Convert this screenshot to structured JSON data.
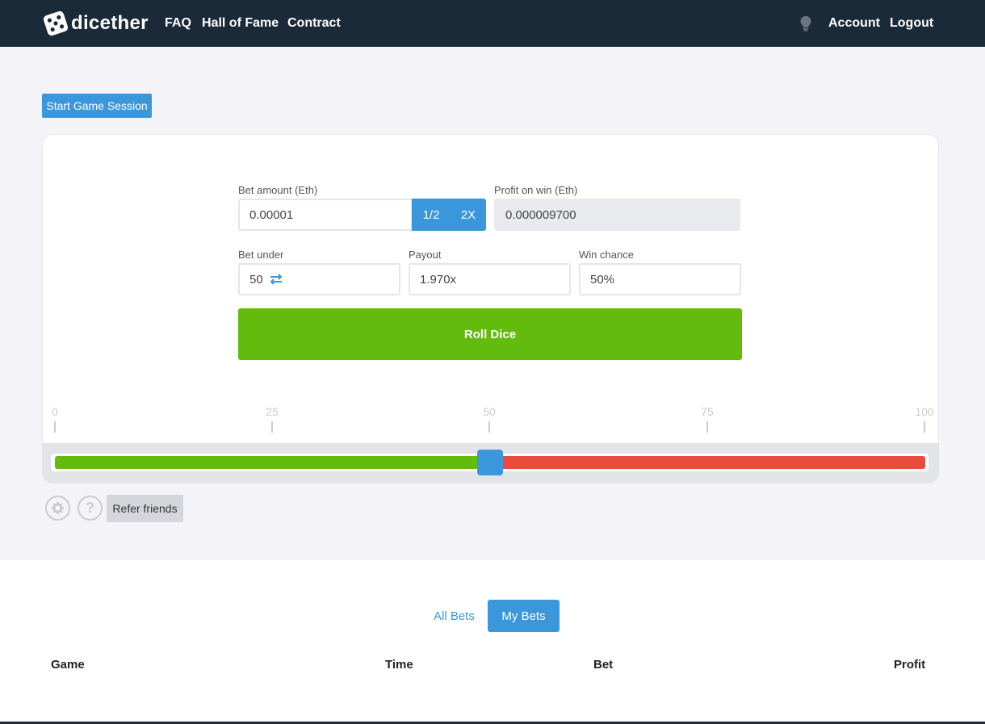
{
  "nav": {
    "brand": "dicether",
    "links": [
      "FAQ",
      "Hall of Fame",
      "Contract"
    ],
    "account": "Account",
    "logout": "Logout"
  },
  "session": {
    "start_label": "Start Game Session"
  },
  "form": {
    "bet_amount_label": "Bet amount (Eth)",
    "bet_amount_value": "0.00001",
    "half_label": "1/2",
    "double_label": "2X",
    "profit_label": "Profit on win (Eth)",
    "profit_value": "0.000009700",
    "bet_under_label": "Bet under",
    "bet_under_value": "50",
    "payout_label": "Payout",
    "payout_value": "1.970x",
    "win_chance_label": "Win chance",
    "win_chance_value": "50%",
    "roll_label": "Roll Dice"
  },
  "slider": {
    "ticks": [
      "0",
      "25",
      "50",
      "75",
      "100"
    ],
    "value": 50,
    "min": 0,
    "max": 100,
    "win_color": "#63bb0d",
    "lose_color": "#e74c3c",
    "handle_color": "#3b97dc"
  },
  "tools": {
    "settings_icon": "gear-icon",
    "help_icon": "question-icon",
    "help_glyph": "?",
    "refer_label": "Refer friends"
  },
  "bets": {
    "tabs": [
      "All Bets",
      "My Bets"
    ],
    "active_tab": "My Bets",
    "columns": [
      "Game",
      "Time",
      "Bet",
      "Profit"
    ]
  },
  "colors": {
    "navbar": "#1b2a38",
    "accent": "#3b97dc",
    "roll_button": "#63bb0d"
  }
}
